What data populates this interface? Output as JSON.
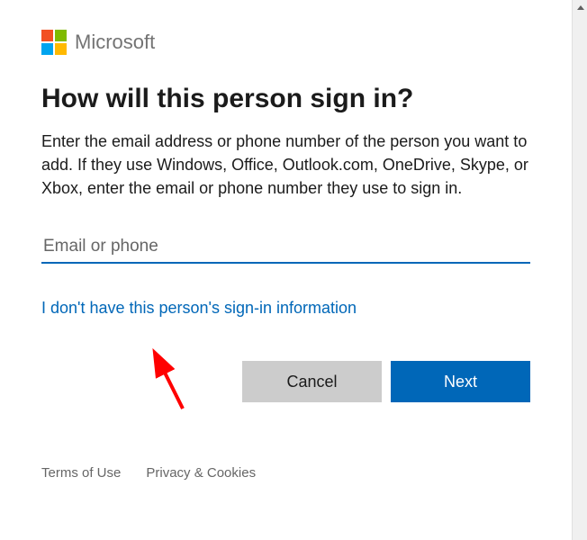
{
  "header": {
    "brand": "Microsoft"
  },
  "title": "How will this person sign in?",
  "description": "Enter the email address or phone number of the person you want to add. If they use Windows, Office, Outlook.com, OneDrive, Skype, or Xbox, enter the email or phone number they use to sign in.",
  "input": {
    "placeholder": "Email or phone",
    "value": ""
  },
  "link_no_info": "I don't have this person's sign-in information",
  "buttons": {
    "cancel": "Cancel",
    "next": "Next"
  },
  "footer": {
    "terms": "Terms of Use",
    "privacy": "Privacy & Cookies"
  }
}
